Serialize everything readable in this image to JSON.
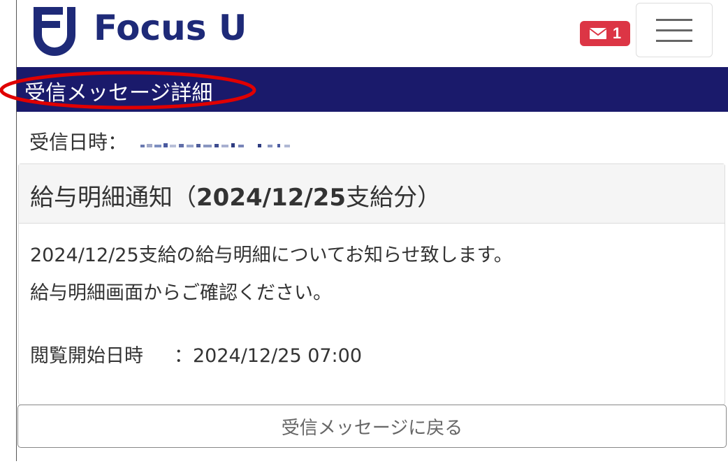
{
  "header": {
    "logo_text": "Focus U",
    "mail_badge_count": "1",
    "brand_color": "#1e2a78",
    "badge_color": "#dc3545"
  },
  "title_bar": {
    "title": "受信メッセージ詳細",
    "background": "#1a1a6b",
    "highlight_color": "#e00000"
  },
  "received": {
    "label": "受信日時："
  },
  "message": {
    "title_prefix": "給与明細通知（",
    "title_date": "2024/12/25",
    "title_suffix": "支給分）",
    "body_line1": "2024/12/25支給の給与明細についてお知らせ致します。",
    "body_line2": "給与明細画面からご確認ください。",
    "view_label": "閲覧開始日時",
    "view_value": "：2024/12/25 07:00"
  },
  "actions": {
    "back_label": "受信メッセージに戻る"
  }
}
